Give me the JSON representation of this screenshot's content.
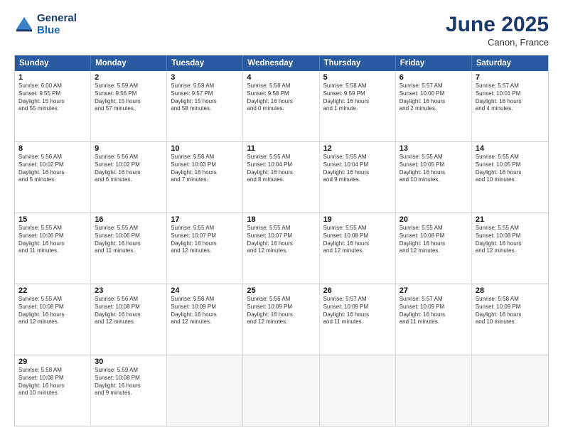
{
  "header": {
    "logo_line1": "General",
    "logo_line2": "Blue",
    "month_year": "June 2025",
    "location": "Canon, France"
  },
  "weekdays": [
    "Sunday",
    "Monday",
    "Tuesday",
    "Wednesday",
    "Thursday",
    "Friday",
    "Saturday"
  ],
  "rows": [
    [
      {
        "day": "",
        "info": ""
      },
      {
        "day": "2",
        "info": "Sunrise: 5:59 AM\nSunset: 9:56 PM\nDaylight: 15 hours\nand 57 minutes."
      },
      {
        "day": "3",
        "info": "Sunrise: 5:59 AM\nSunset: 9:57 PM\nDaylight: 15 hours\nand 58 minutes."
      },
      {
        "day": "4",
        "info": "Sunrise: 5:58 AM\nSunset: 9:58 PM\nDaylight: 16 hours\nand 0 minutes."
      },
      {
        "day": "5",
        "info": "Sunrise: 5:58 AM\nSunset: 9:59 PM\nDaylight: 16 hours\nand 1 minute."
      },
      {
        "day": "6",
        "info": "Sunrise: 5:57 AM\nSunset: 10:00 PM\nDaylight: 16 hours\nand 2 minutes."
      },
      {
        "day": "7",
        "info": "Sunrise: 5:57 AM\nSunset: 10:01 PM\nDaylight: 16 hours\nand 4 minutes."
      }
    ],
    [
      {
        "day": "8",
        "info": "Sunrise: 5:56 AM\nSunset: 10:02 PM\nDaylight: 16 hours\nand 5 minutes."
      },
      {
        "day": "9",
        "info": "Sunrise: 5:56 AM\nSunset: 10:02 PM\nDaylight: 16 hours\nand 6 minutes."
      },
      {
        "day": "10",
        "info": "Sunrise: 5:56 AM\nSunset: 10:03 PM\nDaylight: 16 hours\nand 7 minutes."
      },
      {
        "day": "11",
        "info": "Sunrise: 5:55 AM\nSunset: 10:04 PM\nDaylight: 16 hours\nand 8 minutes."
      },
      {
        "day": "12",
        "info": "Sunrise: 5:55 AM\nSunset: 10:04 PM\nDaylight: 16 hours\nand 9 minutes."
      },
      {
        "day": "13",
        "info": "Sunrise: 5:55 AM\nSunset: 10:05 PM\nDaylight: 16 hours\nand 10 minutes."
      },
      {
        "day": "14",
        "info": "Sunrise: 5:55 AM\nSunset: 10:05 PM\nDaylight: 16 hours\nand 10 minutes."
      }
    ],
    [
      {
        "day": "15",
        "info": "Sunrise: 5:55 AM\nSunset: 10:06 PM\nDaylight: 16 hours\nand 11 minutes."
      },
      {
        "day": "16",
        "info": "Sunrise: 5:55 AM\nSunset: 10:06 PM\nDaylight: 16 hours\nand 11 minutes."
      },
      {
        "day": "17",
        "info": "Sunrise: 5:55 AM\nSunset: 10:07 PM\nDaylight: 16 hours\nand 12 minutes."
      },
      {
        "day": "18",
        "info": "Sunrise: 5:55 AM\nSunset: 10:07 PM\nDaylight: 16 hours\nand 12 minutes."
      },
      {
        "day": "19",
        "info": "Sunrise: 5:55 AM\nSunset: 10:08 PM\nDaylight: 16 hours\nand 12 minutes."
      },
      {
        "day": "20",
        "info": "Sunrise: 5:55 AM\nSunset: 10:08 PM\nDaylight: 16 hours\nand 12 minutes."
      },
      {
        "day": "21",
        "info": "Sunrise: 5:55 AM\nSunset: 10:08 PM\nDaylight: 16 hours\nand 12 minutes."
      }
    ],
    [
      {
        "day": "22",
        "info": "Sunrise: 5:55 AM\nSunset: 10:08 PM\nDaylight: 16 hours\nand 12 minutes."
      },
      {
        "day": "23",
        "info": "Sunrise: 5:56 AM\nSunset: 10:08 PM\nDaylight: 16 hours\nand 12 minutes."
      },
      {
        "day": "24",
        "info": "Sunrise: 5:56 AM\nSunset: 10:09 PM\nDaylight: 16 hours\nand 12 minutes."
      },
      {
        "day": "25",
        "info": "Sunrise: 5:56 AM\nSunset: 10:09 PM\nDaylight: 16 hours\nand 12 minutes."
      },
      {
        "day": "26",
        "info": "Sunrise: 5:57 AM\nSunset: 10:09 PM\nDaylight: 16 hours\nand 11 minutes."
      },
      {
        "day": "27",
        "info": "Sunrise: 5:57 AM\nSunset: 10:09 PM\nDaylight: 16 hours\nand 11 minutes."
      },
      {
        "day": "28",
        "info": "Sunrise: 5:58 AM\nSunset: 10:09 PM\nDaylight: 16 hours\nand 10 minutes."
      }
    ],
    [
      {
        "day": "29",
        "info": "Sunrise: 5:58 AM\nSunset: 10:08 PM\nDaylight: 16 hours\nand 10 minutes."
      },
      {
        "day": "30",
        "info": "Sunrise: 5:59 AM\nSunset: 10:08 PM\nDaylight: 16 hours\nand 9 minutes."
      },
      {
        "day": "",
        "info": ""
      },
      {
        "day": "",
        "info": ""
      },
      {
        "day": "",
        "info": ""
      },
      {
        "day": "",
        "info": ""
      },
      {
        "day": "",
        "info": ""
      }
    ]
  ],
  "row0_day1": {
    "day": "1",
    "info": "Sunrise: 6:00 AM\nSunset: 9:55 PM\nDaylight: 15 hours\nand 55 minutes."
  }
}
